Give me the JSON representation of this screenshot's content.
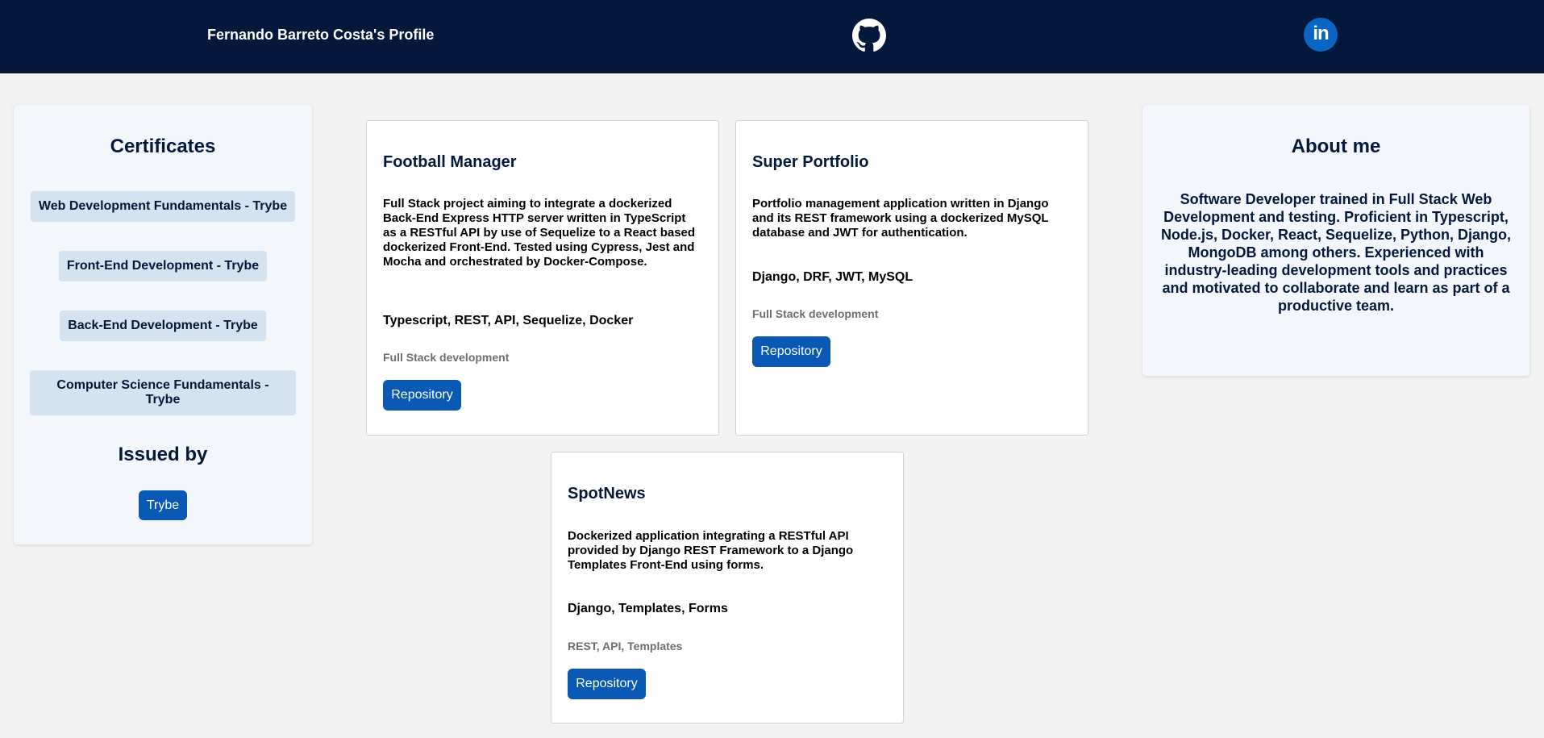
{
  "header": {
    "title": "Fernando Barreto Costa's Profile",
    "github_icon": "github-icon",
    "linkedin_icon": "linkedin-icon",
    "linkedin_glyph": "in"
  },
  "certificates": {
    "heading": "Certificates",
    "items": [
      "Web Development Fundamentals - Trybe",
      "Front-End Development - Trybe",
      "Back-End Development - Trybe",
      "Computer Science Fundamentals - Trybe"
    ],
    "issued_heading": "Issued by",
    "issuer_button": "Trybe"
  },
  "projects": [
    {
      "title": "Football Manager",
      "description": "Full Stack project aiming to integrate a dockerized Back-End Express HTTP server written in TypeScript as a RESTful API by use of Sequelize to a React based dockerized Front-End. Tested using Cypress, Jest and Mocha and orchestrated by Docker-Compose.",
      "stack": "Typescript, REST, API, Sequelize, Docker",
      "category": "Full Stack development",
      "button": "Repository"
    },
    {
      "title": "Super Portfolio",
      "description": "Portfolio management application written in Django and its REST framework using a dockerized MySQL database and JWT for authentication.",
      "stack": "Django, DRF, JWT, MySQL",
      "category": "Full Stack development",
      "button": "Repository"
    },
    {
      "title": "SpotNews",
      "description": "Dockerized application integrating a RESTful API provided by Django REST Framework to a Django Templates Front-End using forms.",
      "stack": "Django, Templates, Forms",
      "category": "REST, API, Templates",
      "button": "Repository"
    }
  ],
  "about": {
    "heading": "About me",
    "text": "Software Developer trained in Full Stack Web Development and testing. Proficient in Typescript, Node.js, Docker, React, Sequelize, Python, Django, MongoDB among others. Experienced with industry-leading development tools and practices and motivated to collaborate and learn as part of a productive team."
  },
  "colors": {
    "header_bg": "#03183a",
    "button_bg": "#0a59b5",
    "chip_bg": "#d3e3f1",
    "linkedin_bg": "#0a66c2"
  }
}
